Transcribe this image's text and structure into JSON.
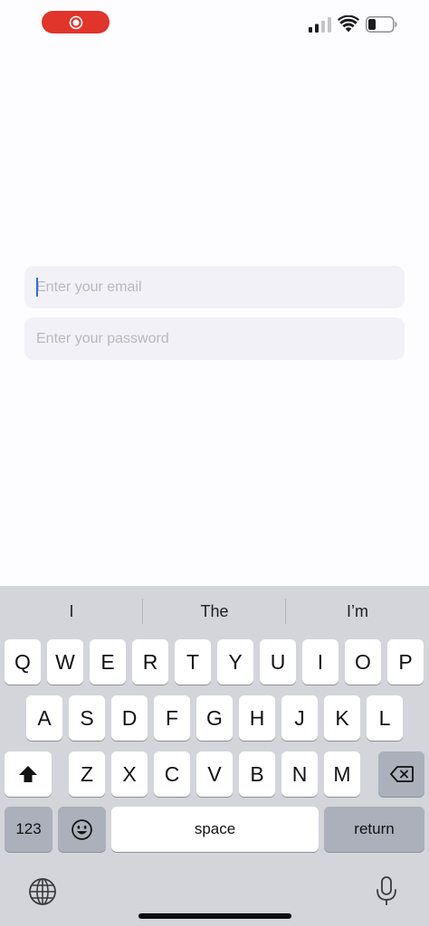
{
  "status_bar": {
    "record_icon": "screen-record-icon",
    "signal_icon": "cellular-signal-icon",
    "wifi_icon": "wifi-icon",
    "battery_icon": "battery-icon",
    "accent": "#e1342b"
  },
  "form": {
    "email_placeholder": "Enter your email",
    "email_value": "",
    "password_placeholder": "Enter your password",
    "password_value": ""
  },
  "keyboard": {
    "predictions": [
      "I",
      "The",
      "I’m"
    ],
    "row1": [
      "Q",
      "W",
      "E",
      "R",
      "T",
      "Y",
      "U",
      "I",
      "O",
      "P"
    ],
    "row2": [
      "A",
      "S",
      "D",
      "F",
      "G",
      "H",
      "J",
      "K",
      "L"
    ],
    "row3": [
      "Z",
      "X",
      "C",
      "V",
      "B",
      "N",
      "M"
    ],
    "shift_icon": "shift-arrow-icon",
    "delete_icon": "backspace-icon",
    "numbers_label": "123",
    "emoji_icon": "emoji-icon",
    "space_label": "space",
    "return_label": "return",
    "globe_icon": "globe-icon",
    "mic_icon": "microphone-icon"
  }
}
